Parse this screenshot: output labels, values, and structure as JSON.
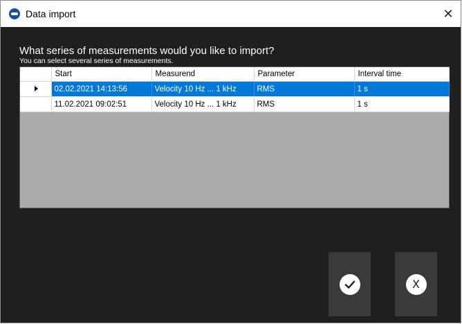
{
  "window": {
    "title": "Data import",
    "close_glyph": "✕"
  },
  "main": {
    "question": "What series of measurements would you like to import?",
    "hint": "You can select several series of measurements."
  },
  "table": {
    "columns": [
      "Start",
      "Measurend",
      "Parameter",
      "Interval time"
    ],
    "rows": [
      {
        "start": "02.02.2021 14:13:56",
        "measurend": "Velocity 10 Hz ... 1 kHz",
        "parameter": "RMS",
        "interval": "1 s",
        "selected": true
      },
      {
        "start": "11.02.2021 09:02:51",
        "measurend": "Velocity 10 Hz ... 1 kHz",
        "parameter": "RMS",
        "interval": "1 s",
        "selected": false
      }
    ]
  },
  "buttons": {
    "ok_icon": "checkmark-icon",
    "cancel_label": "X"
  },
  "colors": {
    "selection": "#0078d7",
    "background": "#1f1f1f",
    "grid_empty": "#ababab",
    "button": "#3a3a3a"
  }
}
